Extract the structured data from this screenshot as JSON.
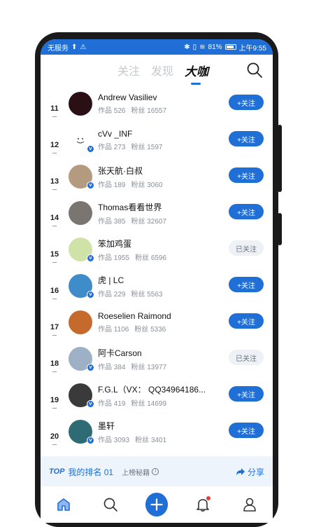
{
  "status": {
    "carrier": "无服务",
    "battery": "81%",
    "time": "上午9:55"
  },
  "tabs": [
    {
      "label": "关注"
    },
    {
      "label": "发现"
    },
    {
      "label": "大咖"
    }
  ],
  "stats_labels": {
    "works": "作品",
    "fans": "粉丝"
  },
  "rows": [
    {
      "rank": "11",
      "name": "Andrew Vasiliev",
      "works": "526",
      "fans": "16557",
      "button": "+关注",
      "followed": false,
      "avatar_color": "#2a0f14",
      "verified": false
    },
    {
      "rank": "12",
      "name": "cVv _INF",
      "works": "273",
      "fans": "1597",
      "button": "+关注",
      "followed": false,
      "avatar_color": "#ffffff",
      "verified": true
    },
    {
      "rank": "13",
      "name": "张天航·白叔",
      "works": "189",
      "fans": "3060",
      "button": "+关注",
      "followed": false,
      "avatar_color": "#b49a7e",
      "verified": true
    },
    {
      "rank": "14",
      "name": "Thomas看看世界",
      "works": "385",
      "fans": "32607",
      "button": "+关注",
      "followed": false,
      "avatar_color": "#7a7570",
      "verified": false
    },
    {
      "rank": "15",
      "name": "笨加鸡蛋",
      "works": "1955",
      "fans": "6596",
      "button": "已关注",
      "followed": true,
      "avatar_color": "#cfe3a8",
      "verified": true
    },
    {
      "rank": "16",
      "name": "虎 | LC",
      "works": "229",
      "fans": "5563",
      "button": "+关注",
      "followed": false,
      "avatar_color": "#3f8ccb",
      "verified": true
    },
    {
      "rank": "17",
      "name": "Roeselien Raimond",
      "works": "1106",
      "fans": "5336",
      "button": "+关注",
      "followed": false,
      "avatar_color": "#c56a2c",
      "verified": false
    },
    {
      "rank": "18",
      "name": "阿卡Carson",
      "works": "384",
      "fans": "13977",
      "button": "已关注",
      "followed": true,
      "avatar_color": "#9eb0c6",
      "verified": true
    },
    {
      "rank": "19",
      "name": "F.G.L（VX： QQ34964186...",
      "works": "419",
      "fans": "14699",
      "button": "+关注",
      "followed": false,
      "avatar_color": "#3a3a3a",
      "verified": true
    },
    {
      "rank": "20",
      "name": "墨轩",
      "works": "3093",
      "fans": "3401",
      "button": "+关注",
      "followed": false,
      "avatar_color": "#2f6b74",
      "verified": true
    }
  ],
  "mybar": {
    "logo": "TOP",
    "my_rank": "我的排名 01",
    "tips": "上榜秘籍",
    "share": "分享"
  },
  "colors": {
    "accent": "#1f6fd6",
    "reddot": "#e0413a"
  }
}
